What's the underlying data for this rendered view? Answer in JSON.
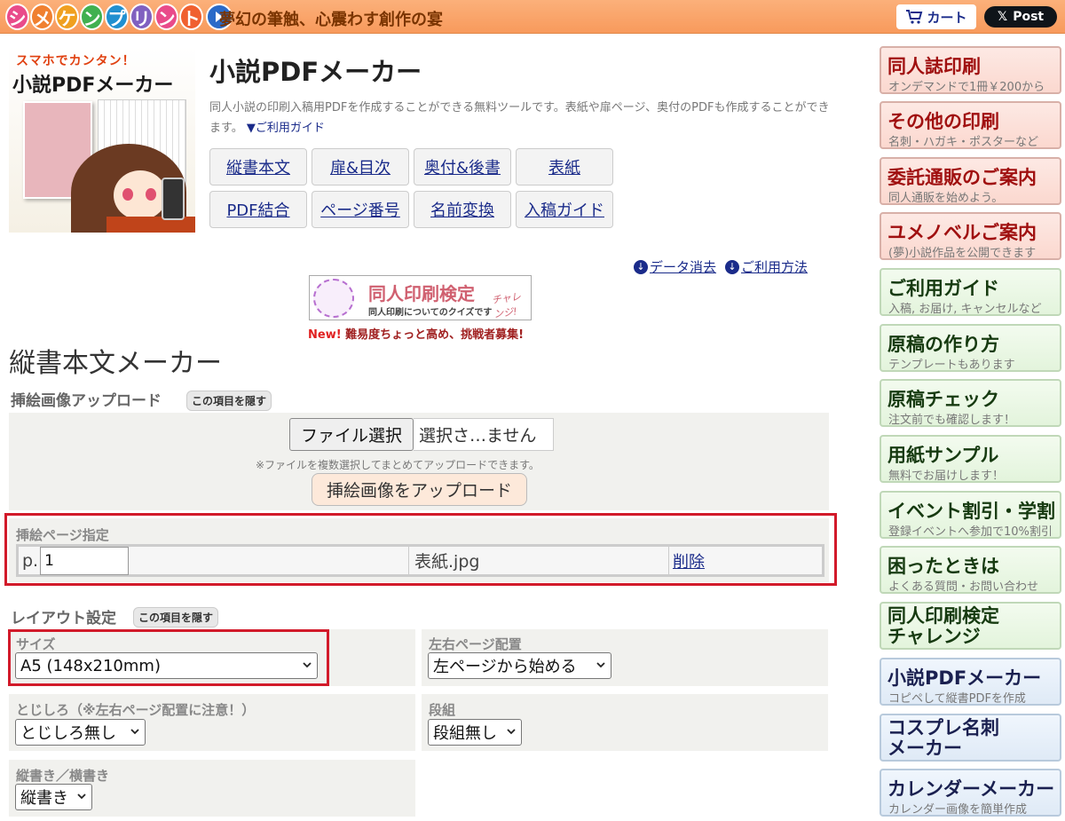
{
  "header": {
    "logo_chars": [
      "シ",
      "メ",
      "ケ",
      "ン",
      "プ",
      "リ",
      "ン",
      "ト"
    ],
    "logo_colors": [
      "#e94b8a",
      "#f08030",
      "#f0a020",
      "#40b050",
      "#2090d0",
      "#8060c0",
      "#e94b8a",
      "#f06030"
    ],
    "tagline": "夢幻の筆触、心震わす創作の宴",
    "cart_label": "カート",
    "x_post_label": "Post"
  },
  "hero": {
    "small_title": "スマホでカンタン！",
    "big_title": "小説PDFメーカー"
  },
  "page": {
    "title": "小説PDFメーカー",
    "description": "同人小説の印刷入稿用PDFを作成することができる無料ツールです。表紙や扉ページ、奥付のPDFも作成することができます。",
    "guide_link": "▼ご利用ガイド",
    "nav": [
      "縦書本文",
      "扉&目次",
      "奥付&後書",
      "表紙",
      "PDF結合",
      "ページ番号",
      "名前変換",
      "入稿ガイド"
    ],
    "util_links": [
      "データ消去",
      "ご利用方法"
    ]
  },
  "quiz": {
    "title": "同人印刷検定",
    "challenge": "チャレンジ!",
    "sub": "同人印刷についてのクイズです",
    "note_new": "New!",
    "note_text": "難易度ちょっと高め、挑戦者募集!"
  },
  "section": {
    "title": "縦書本文メーカー"
  },
  "upload": {
    "heading": "挿絵画像アップロード",
    "hide_label": "この項目を隠す",
    "file_button": "ファイル選択",
    "file_status": "選択さ…ません",
    "note": "※ファイルを複数選択してまとめてアップロードできます。",
    "upload_button": "挿絵画像をアップロード"
  },
  "pages": {
    "label": "挿絵ページ指定",
    "prefix": "p.",
    "page_value": "1",
    "filename": "表紙.jpg",
    "delete_label": "削除"
  },
  "layout": {
    "heading": "レイアウト設定",
    "hide_label": "この項目を隠す",
    "size_label": "サイズ",
    "size_value": "A5 (148x210mm)",
    "spread_label": "左右ページ配置",
    "spread_value": "左ページから始める",
    "gutter_label": "とじしろ（※左右ページ配置に注意！）",
    "gutter_value": "とじしろ無し",
    "columns_label": "段組",
    "columns_value": "段組無し",
    "direction_label": "縦書き／横書き",
    "direction_value": "縦書き"
  },
  "sidebar": [
    {
      "title": "同人誌印刷",
      "sub": "オンデマンドで1冊￥200から",
      "style": "red"
    },
    {
      "title": "その他の印刷",
      "sub": "名刺・ハガキ・ポスターなど",
      "style": "red"
    },
    {
      "title": "委託通販のご案内",
      "sub": "同人通販を始めよう。",
      "style": "red"
    },
    {
      "title": "ユメノベルご案内",
      "sub": "(夢)小説作品を公開できます",
      "style": "red"
    },
    {
      "title": "ご利用ガイド",
      "sub": "入稿, お届け, キャンセルなど",
      "style": "green"
    },
    {
      "title": "原稿の作り方",
      "sub": "テンプレートもあります",
      "style": "green"
    },
    {
      "title": "原稿チェック",
      "sub": "注文前でも確認します！",
      "style": "green"
    },
    {
      "title": "用紙サンプル",
      "sub": "無料でお届けします！",
      "style": "green"
    },
    {
      "title": "イベント割引・学割",
      "sub": "登録イベントへ参加で10%割引",
      "style": "green"
    },
    {
      "title": "困ったときは",
      "sub": "よくある質問・お問い合わせ",
      "style": "green"
    },
    {
      "title": "同人印刷検定\nチャレンジ",
      "sub": "",
      "style": "green"
    },
    {
      "title": "小説PDFメーカー",
      "sub": "コピペして縦書PDFを作成",
      "style": "blue"
    },
    {
      "title": "コスプレ名刺\nメーカー",
      "sub": "",
      "style": "blue"
    },
    {
      "title": "カレンダーメーカー",
      "sub": "カレンダー画像を簡単作成",
      "style": "blue"
    }
  ]
}
